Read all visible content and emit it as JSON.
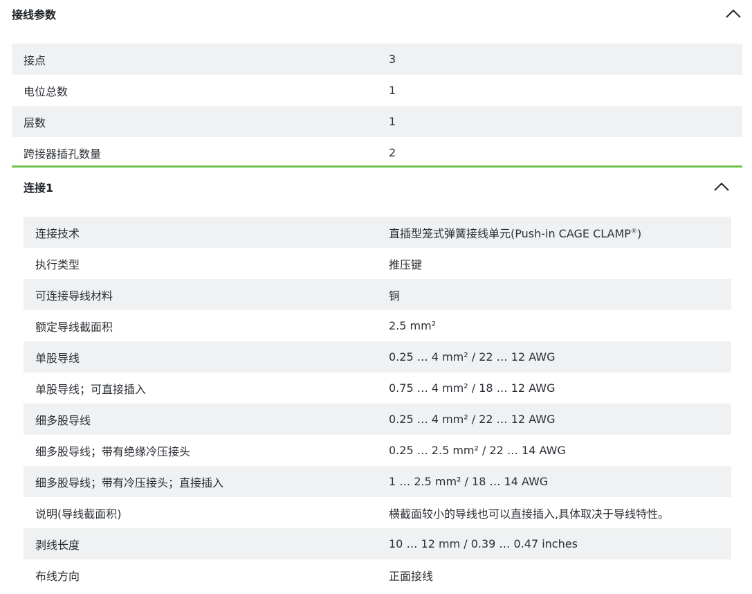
{
  "general": {
    "title": "接线参数",
    "rows": [
      {
        "label": "接点",
        "value": "3"
      },
      {
        "label": "电位总数",
        "value": "1"
      },
      {
        "label": "层数",
        "value": "1"
      },
      {
        "label": "跨接器插孔数量",
        "value": "2"
      }
    ]
  },
  "connection1": {
    "title": "连接1",
    "rows": [
      {
        "label": "连接技术",
        "value": "直插型笼式弹簧接线单元(Push-in CAGE CLAMP",
        "value_sup": "®",
        "value_suffix": ")"
      },
      {
        "label": "执行类型",
        "value": "推压键"
      },
      {
        "label": "可连接导线材料",
        "value": "铜"
      },
      {
        "label": "额定导线截面积",
        "value": "2.5 mm²"
      },
      {
        "label": "单股导线",
        "value": "0.25 … 4 mm² / 22 … 12 AWG"
      },
      {
        "label": "单股导线；可直接插入",
        "value": "0.75 … 4 mm² / 18 … 12 AWG"
      },
      {
        "label": "细多股导线",
        "value": "0.25 … 4 mm² / 22 … 12 AWG"
      },
      {
        "label": "细多股导线；带有绝缘冷压接头",
        "value": "0.25 … 2.5 mm² / 22 … 14 AWG"
      },
      {
        "label": "细多股导线；带有冷压接头；直接插入",
        "value": "1 … 2.5 mm² / 18 … 14 AWG"
      },
      {
        "label": "说明(导线截面积)",
        "value": "横截面较小的导线也可以直接插入,具体取决于导线特性。"
      },
      {
        "label": "剥线长度",
        "value": "10 … 12 mm / 0.39 … 0.47 inches"
      },
      {
        "label": "布线方向",
        "value": "正面接线"
      }
    ]
  },
  "icons": {
    "collapse": "chevron-up-icon"
  },
  "colors": {
    "accent": "#6cc24a",
    "row_stripe": "#f0f1f2"
  }
}
